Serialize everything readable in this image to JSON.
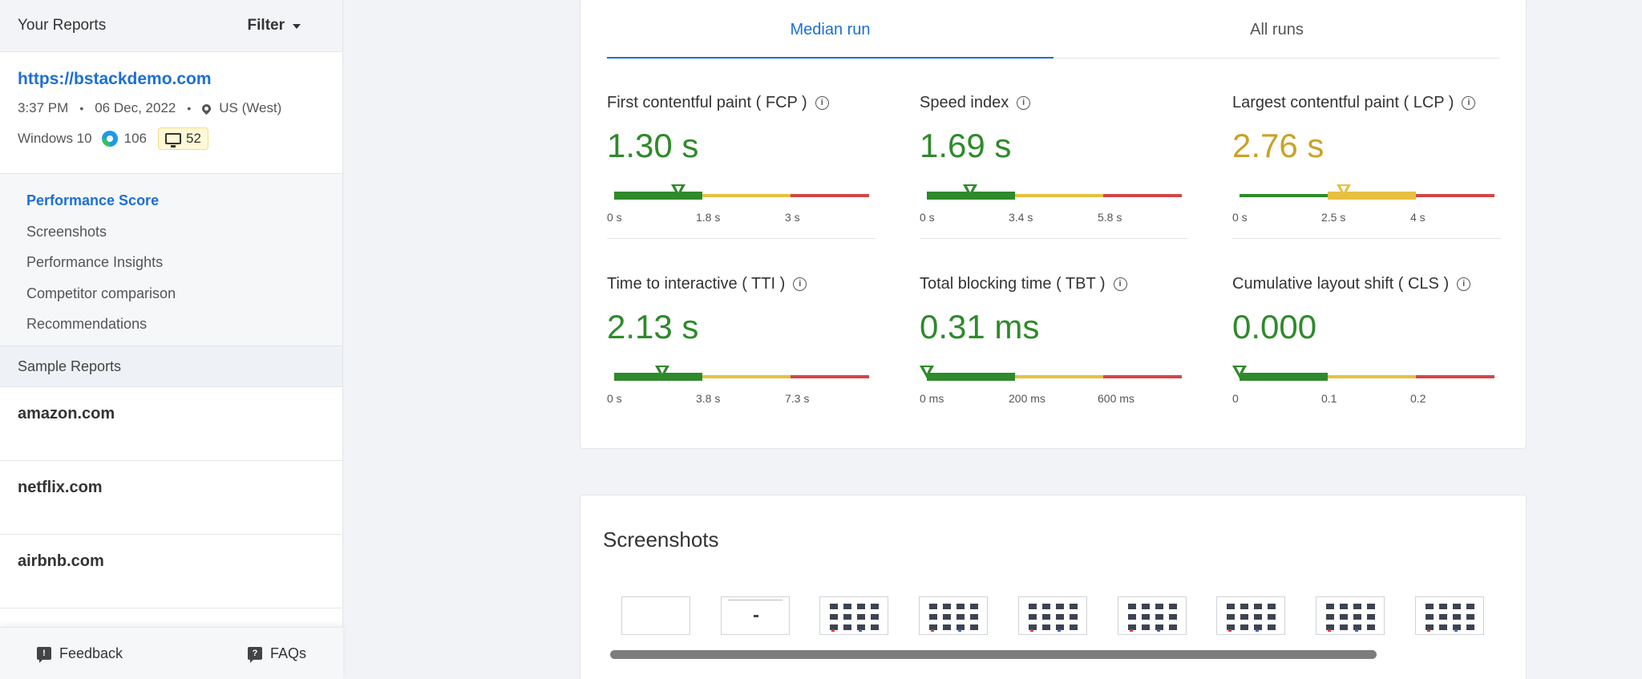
{
  "sidebar": {
    "title": "Your Reports",
    "filter_label": "Filter",
    "report": {
      "url": "https://bstackdemo.com",
      "time": "3:37 PM",
      "date": "06 Dec, 2022",
      "location": "US (West)",
      "os": "Windows 10",
      "browser_version": "106",
      "resolution_badge": "52"
    },
    "nav": [
      {
        "label": "Performance Score",
        "active": true
      },
      {
        "label": "Screenshots"
      },
      {
        "label": "Performance Insights"
      },
      {
        "label": "Competitor comparison"
      },
      {
        "label": "Recommendations"
      }
    ],
    "sample_heading": "Sample Reports",
    "samples": [
      "amazon.com",
      "netflix.com",
      "airbnb.com"
    ],
    "footer": {
      "feedback": "Feedback",
      "faqs": "FAQs"
    }
  },
  "tabs": [
    "Median run",
    "All runs"
  ],
  "metrics": [
    {
      "label": "First contentful paint ( FCP )",
      "value": "1.30 s",
      "color": "#2e8a2a",
      "level": "good",
      "ticks": [
        "0 s",
        "1.8 s",
        "3 s"
      ],
      "marker_fraction": 0.25
    },
    {
      "label": "Speed index",
      "value": "1.69 s",
      "color": "#2e8a2a",
      "level": "good",
      "ticks": [
        "0 s",
        "3.4 s",
        "5.8 s"
      ],
      "marker_fraction": 0.17
    },
    {
      "label": "Largest contentful paint ( LCP )",
      "value": "2.76 s",
      "color": "#c9a227",
      "level": "average",
      "ticks": [
        "0 s",
        "2.5 s",
        "4 s"
      ],
      "marker_fraction": 0.41
    },
    {
      "label": "Time to interactive ( TTI )",
      "value": "2.13 s",
      "color": "#2e8a2a",
      "level": "good",
      "ticks": [
        "0 s",
        "3.8 s",
        "7.3 s"
      ],
      "marker_fraction": 0.19
    },
    {
      "label": "Total blocking time ( TBT )",
      "value": "0.31 ms",
      "color": "#2e8a2a",
      "level": "good",
      "ticks": [
        "0 ms",
        "200 ms",
        "600 ms"
      ],
      "marker_fraction": 0.0
    },
    {
      "label": "Cumulative layout shift ( CLS )",
      "value": "0.000",
      "color": "#2e8a2a",
      "level": "good",
      "ticks": [
        "0",
        "0.1",
        "0.2"
      ],
      "marker_fraction": 0.0
    }
  ],
  "screenshots": {
    "heading": "Screenshots",
    "count": 9
  },
  "colors": {
    "accent": "#1c6fd4",
    "good": "#2e8a2a",
    "average": "#e6c040",
    "poor": "#d14747"
  }
}
